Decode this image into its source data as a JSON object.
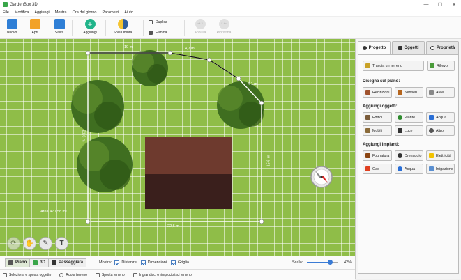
{
  "window": {
    "title": "GardenBox 3D",
    "min": "—",
    "max": "☐",
    "close": "✕"
  },
  "menu": [
    "File",
    "Modifica",
    "Aggiungi",
    "Mostra",
    "Ora del giorno",
    "Parametri",
    "Aiuto"
  ],
  "toolbar": {
    "nuovo": "Nuovo",
    "apri": "Apri",
    "salva": "Salva",
    "aggiungi": "Aggiungi",
    "sole_ombra": "Sole/Ombra",
    "duplica": "Duplica",
    "elimina": "Elimina",
    "annulla": "Annulla",
    "ripristina": "Ripristina"
  },
  "canvas": {
    "measurements": {
      "top_left": "19 m",
      "top_mid": "4,7 m",
      "diag": "4,1 m",
      "left": "21,6 m",
      "right": "15,6 m",
      "bottom": "22,6 m",
      "area": "Area 470,58 m²"
    },
    "colors": {
      "grass": "#8fbd48",
      "house_roof": "#6e3a2e",
      "house_shadow": "#3a1f1c"
    }
  },
  "panel": {
    "tabs": {
      "progetto": "Progetto",
      "oggetti": "Oggetti",
      "proprieta": "Proprietà"
    },
    "traccia_terreno": "Traccia un terreno",
    "rilievo": "Rilievo",
    "sections": {
      "disegna": "Disegna sul piano:",
      "oggetti": "Aggiungi oggetti:",
      "impianti": "Aggiungi impianti:"
    },
    "disegna": [
      "Recinzioni",
      "Sentieri",
      "Aree"
    ],
    "oggetti": [
      "Edifici",
      "Piante",
      "Acqua",
      "Mobili",
      "Luce",
      "Altro"
    ],
    "impianti": [
      "Fognatura",
      "Drenaggio",
      "Elettricità",
      "Gas",
      "Acqua",
      "Irrigazione"
    ]
  },
  "bottom": {
    "views": {
      "piano": "Piano",
      "tre_d": "3D",
      "passeggiata": "Passeggiata"
    },
    "mostra": "Mostra:",
    "checks": {
      "distanze": "Distanze",
      "dimensioni": "Dimensioni",
      "griglia": "Griglia"
    },
    "scala": "Scala:",
    "zoom": "42%",
    "zoom_level": 0.75
  },
  "status": [
    "Seleziona e sposta oggetto",
    "Ruota terreno",
    "Sposta terreno",
    "Ingrandisci o rimpicciolisci terreno"
  ]
}
